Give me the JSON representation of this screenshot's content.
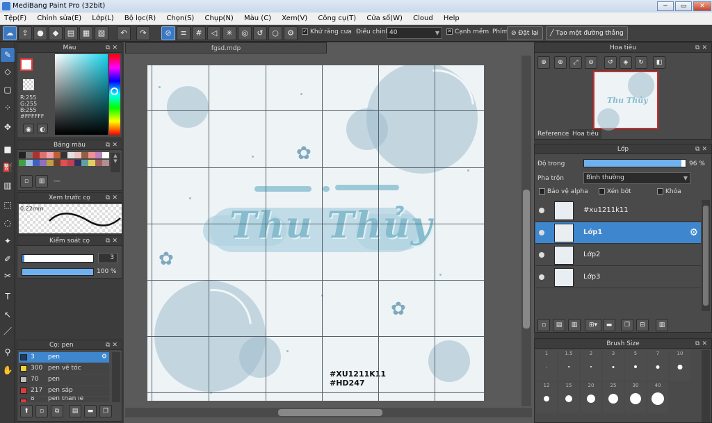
{
  "window": {
    "title": "MediBang Paint Pro (32bit)",
    "min": "─",
    "max": "▭",
    "close": "✕"
  },
  "menu": [
    "Tệp(F)",
    "Chỉnh sửa(E)",
    "Lớp(L)",
    "Bộ lọc(R)",
    "Chọn(S)",
    "Chụp(N)",
    "Màu (C)",
    "Xem(V)",
    "Công cụ(T)",
    "Cửa số(W)",
    "Cloud",
    "Help"
  ],
  "toolbar": {
    "antialias_label": "Khử răng cưa",
    "adjust_label": "Điều chinh",
    "adjust_value": "40",
    "edge_label": "Cạnh mềm",
    "key_label": "Phím",
    "reset_label": "Đặt lại",
    "create_line_label": "Tạo một đường thẳng"
  },
  "document": {
    "tab": "fgsd.mdp"
  },
  "color_panel": {
    "title": "Màu",
    "r": "R:255",
    "g": "G:255",
    "b": "B:255",
    "hex": "#FFFFFF"
  },
  "palette_panel": {
    "title": "Bảng màu",
    "placeholder": "---"
  },
  "preview_panel": {
    "title": "Xem trước cọ",
    "size": "0.22mm"
  },
  "control_panel": {
    "title": "Kiểm soát cọ",
    "size_value": "3",
    "opacity_value": "100 %",
    "opacity_fraction": 1.0
  },
  "brush_panel": {
    "title": "Cọ: pen",
    "brushes": [
      {
        "size": "3",
        "name": "pen",
        "color": "#1e3a5f"
      },
      {
        "size": "300",
        "name": "pen vẽ tóc",
        "color": "#f3d235"
      },
      {
        "size": "70",
        "name": "pen",
        "color": "#bdbdbd"
      },
      {
        "size": "217",
        "name": "pen sáp",
        "color": "#e23b3b"
      },
      {
        "size": "8",
        "name": "pen thân lẻ",
        "color": "#e23b3b"
      }
    ]
  },
  "navigator": {
    "title": "Hoa tiêu",
    "tab_reference": "Reference",
    "tab_navigator": "Hoa tiêu"
  },
  "layer_panel": {
    "title": "Lớp",
    "opacity_label": "Độ trong",
    "opacity_value": "96 %",
    "opacity_fraction": 0.96,
    "blend_label": "Pha trộn",
    "blend_value": "Bình thường",
    "protect_alpha": "Bảo vệ alpha",
    "clipping": "Xén bớt",
    "lock": "Khóa",
    "layers": [
      "#xu1211k11",
      "Lớp1",
      "Lớp2",
      "Lớp3"
    ]
  },
  "brush_size_panel": {
    "title": "Brush Size",
    "sizes": [
      "1",
      "1.5",
      "2",
      "3",
      "5",
      "7",
      "10",
      "12",
      "15",
      "20",
      "25",
      "30",
      "40"
    ]
  },
  "artwork": {
    "title": "Thu Thủy",
    "tag1": "#XU1211K11",
    "tag2": "#HD247"
  },
  "colors": {
    "accent": "#3e87cf",
    "panel_bg": "#4a4a4a",
    "canvas_bg": "#eef3f6"
  }
}
